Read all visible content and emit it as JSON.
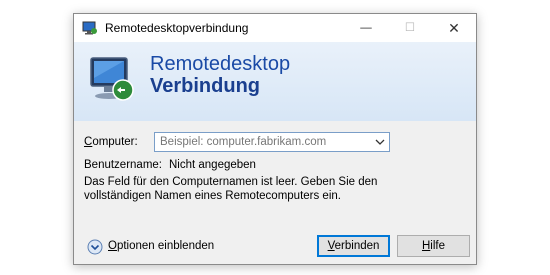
{
  "window": {
    "title": "Remotedesktopverbindung",
    "controls": {
      "minimize": "—",
      "maximize": "☐",
      "close": "✕"
    }
  },
  "banner": {
    "line1": "Remotedesktop",
    "line2": "Verbindung",
    "icon": "remote-desktop-monitor-icon"
  },
  "form": {
    "computer_label_access_key": "C",
    "computer_label_rest": "omputer:",
    "computer_placeholder": "Beispiel: computer.fabrikam.com",
    "computer_value": "",
    "username_label": "Benutzername:",
    "username_value": "Nicht angegeben",
    "info_text": "Das Feld für den Computernamen ist leer. Geben Sie den vollständigen Namen eines Remotecomputers ein."
  },
  "footer": {
    "options_access_key": "O",
    "options_rest": "ptionen einblenden",
    "options_icon": "expand-chevron-icon",
    "connect_access_key": "V",
    "connect_rest": "erbinden",
    "help_access_key": "H",
    "help_rest": "ilfe"
  },
  "colors": {
    "banner_text": "#1a4aa6",
    "focus_border": "#0078d7"
  }
}
